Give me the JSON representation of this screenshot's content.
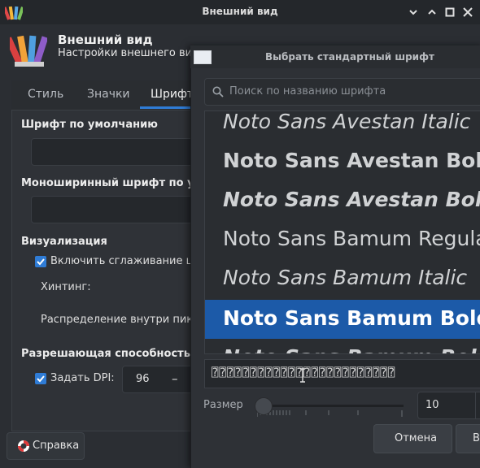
{
  "window": {
    "title": "Внешний вид",
    "controls": [
      "chevron-down-icon",
      "chevron-up-icon",
      "maximize-icon",
      "close-icon"
    ]
  },
  "header": {
    "title": "Внешний вид",
    "subtitle": "Настройки внешнего вида"
  },
  "tabs": [
    {
      "label": "Стиль",
      "active": false
    },
    {
      "label": "Значки",
      "active": false
    },
    {
      "label": "Шрифт",
      "active": true
    }
  ],
  "fonts_tab": {
    "default_font_title": "Шрифт по умолчанию",
    "mono_font_title": "Моноширинный шрифт по умолч",
    "rendering_title": "Визуализация",
    "antialias_label": "Включить сглаживание шри",
    "antialias_checked": true,
    "hinting_label": "Хинтинг:",
    "subpixel_label": "Распределение внутри пиксел",
    "resolution_title": "Разрешающая способность (DP",
    "dpi_label": "Задать DPI:",
    "dpi_checked": true,
    "dpi_value": "96",
    "dpi_minus": "–"
  },
  "help_button": {
    "label": "Справка"
  },
  "dialog": {
    "title": "Выбрать стандартный шрифт",
    "search_placeholder": "Поиск по названию шрифта",
    "fonts": [
      {
        "name": "Noto Sans Avestan Italic",
        "bold": false,
        "italic": true,
        "selected": false
      },
      {
        "name": "Noto Sans Avestan Bold",
        "bold": true,
        "italic": false,
        "selected": false
      },
      {
        "name": "Noto Sans Avestan Bold It",
        "bold": true,
        "italic": true,
        "selected": false
      },
      {
        "name": "Noto Sans Bamum Regular",
        "bold": false,
        "italic": false,
        "selected": false
      },
      {
        "name": "Noto Sans Bamum Italic",
        "bold": false,
        "italic": true,
        "selected": false
      },
      {
        "name": "Noto Sans Bamum Bold",
        "bold": true,
        "italic": false,
        "selected": true
      },
      {
        "name": "Noto Sans Bamum Bold It",
        "bold": true,
        "italic": true,
        "selected": false
      }
    ],
    "preview_text": "⍰⍰⍰⍰⍰⍰⍰⍰⍰⍰⍰⍰⍰⍰⍰⍰⍰⍰⍰⍰⍰⍰⍰⍰",
    "size_label": "Размер",
    "size_value": "10",
    "cancel_label": "Отмена",
    "ok_label": "В"
  },
  "colors": {
    "accent": "#2f7cd6",
    "selection": "#1c5aa8",
    "background": "#2b2e33"
  }
}
